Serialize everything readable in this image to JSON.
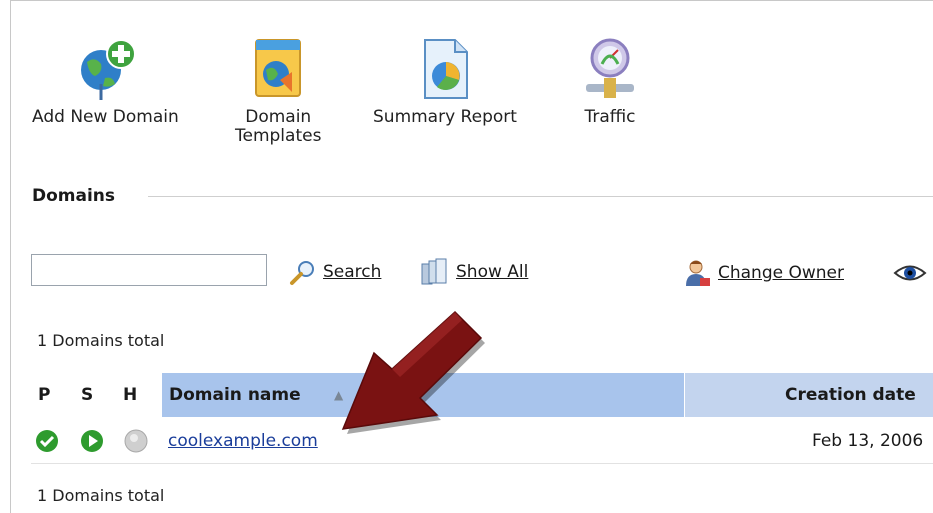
{
  "toolbar": {
    "add_domain": "Add New Domain",
    "templates_line1": "Domain",
    "templates_line2": "Templates",
    "summary": "Summary Report",
    "traffic": "Traffic"
  },
  "section": {
    "title": "Domains"
  },
  "search": {
    "value": "",
    "search_label": "Search",
    "show_all_label": "Show All",
    "change_owner_label": "Change Owner"
  },
  "totals": {
    "top": "1 Domains total",
    "bottom": "1 Domains total"
  },
  "table": {
    "headers": {
      "p": "P",
      "s": "S",
      "h": "H",
      "name": "Domain name",
      "sort_indicator": "▲",
      "created": "Creation date"
    },
    "rows": [
      {
        "domain": "coolexample.com",
        "created": "Feb 13, 2006",
        "status_icons": [
          "check-circle-icon",
          "play-circle-icon",
          "gray-circle-icon"
        ]
      }
    ]
  },
  "colors": {
    "header_bg": "#a8c4ec",
    "link": "#1a3d9a",
    "status_green": "#2e9b2e",
    "arrow": "#7a1212"
  },
  "icons": [
    "globe-add-icon",
    "domain-templates-icon",
    "summary-report-icon",
    "traffic-icon",
    "search-icon",
    "show-all-icon",
    "change-owner-icon",
    "eye-icon"
  ]
}
